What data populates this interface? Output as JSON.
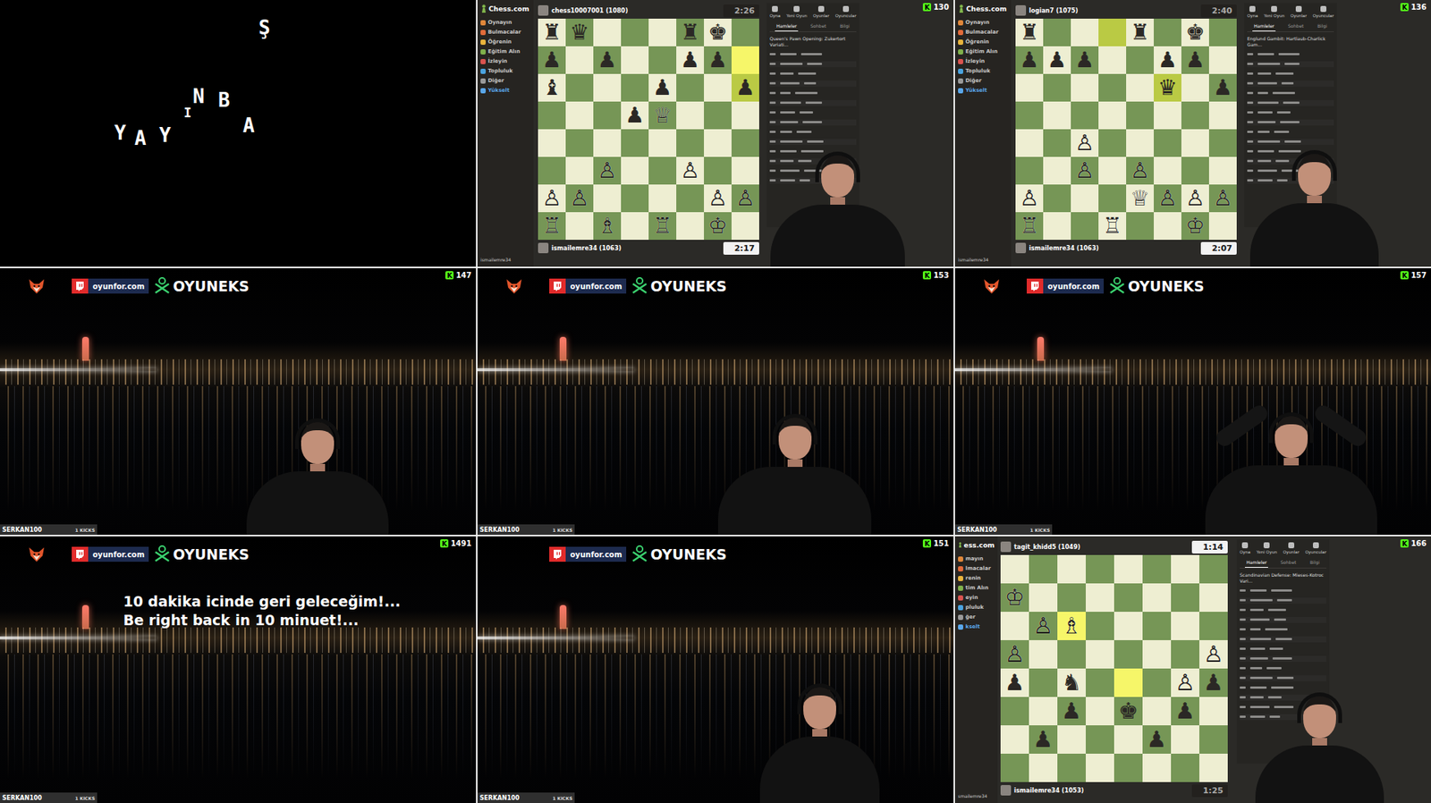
{
  "kick_glyph": "K",
  "tiles": [
    {
      "kind": "intro",
      "letters": [
        "Y",
        "A",
        "Y",
        "I",
        "N",
        "B",
        "A",
        "Ş"
      ]
    },
    {
      "kind": "chess",
      "kicks": "130",
      "on_camera": true,
      "sidebar": {
        "logo": "Chess.com",
        "user": "ismailemre34",
        "items": [
          {
            "label": "Oynayın",
            "accent": false
          },
          {
            "label": "Bulmacalar",
            "accent": false
          },
          {
            "label": "Öğrenin",
            "accent": false
          },
          {
            "label": "Eğitim Alın",
            "accent": false
          },
          {
            "label": "İzleyin",
            "accent": false
          },
          {
            "label": "Topluluk",
            "accent": false
          },
          {
            "label": "Diğer",
            "accent": false
          },
          {
            "label": "Yükselt",
            "accent": true
          }
        ]
      },
      "top_player": {
        "name": "chess10007001 (1080)",
        "clock": {
          "time": "2:26",
          "active": false
        }
      },
      "bottom_player": {
        "name": "ismailemre34 (1063)",
        "clock": {
          "time": "2:17",
          "active": true
        }
      },
      "board": {
        "ranks": [
          "♜♛   ♜♚ ",
          "♟ ♟  ♟♟ ",
          "♝   ♟  ♟",
          "   ♟♕   ",
          "        ",
          "  ♙  ♙  ",
          "♙♙    ♙♙",
          "♖ ♗ ♖ ♔ "
        ],
        "highlights": [
          "h7",
          "h6"
        ]
      },
      "panel": {
        "tabs": [
          "Oyna",
          "Yeni Oyun",
          "Oyunlar",
          "Oyuncular"
        ],
        "subtabs": [
          {
            "label": "Hamleler",
            "selected": true
          },
          {
            "label": "Sohbet",
            "selected": false
          },
          {
            "label": "Bilgi",
            "selected": false
          }
        ],
        "opening": "Queen's Pawn Opening: Zukertort Variati..."
      }
    },
    {
      "kind": "chess",
      "kicks": "136",
      "on_camera": true,
      "sidebar": {
        "logo": "Chess.com",
        "user": "ismailemre34",
        "items": [
          {
            "label": "Oynayın",
            "accent": false
          },
          {
            "label": "Bulmacalar",
            "accent": false
          },
          {
            "label": "Öğrenin",
            "accent": false
          },
          {
            "label": "Eğitim Alın",
            "accent": false
          },
          {
            "label": "İzleyin",
            "accent": false
          },
          {
            "label": "Topluluk",
            "accent": false
          },
          {
            "label": "Diğer",
            "accent": false
          },
          {
            "label": "Yükselt",
            "accent": true
          }
        ]
      },
      "top_player": {
        "name": "logian7 (1075)",
        "clock": {
          "time": "2:40",
          "active": false
        }
      },
      "bottom_player": {
        "name": "ismailemre34 (1063)",
        "clock": {
          "time": "2:07",
          "active": true
        }
      },
      "board": {
        "ranks": [
          "♜   ♜ ♚ ",
          "♟♟♟  ♟♟ ",
          "     ♛ ♟",
          "        ",
          "  ♙     ",
          "  ♙ ♙   ",
          "♙   ♕♙♙♙",
          "♖  ♖  ♔ "
        ],
        "highlights": [
          "d8",
          "f6"
        ]
      },
      "panel": {
        "tabs": [
          "Oyna",
          "Yeni Oyun",
          "Oyunlar",
          "Oyuncular"
        ],
        "subtabs": [
          {
            "label": "Hamleler",
            "selected": true
          },
          {
            "label": "Sohbet",
            "selected": false
          },
          {
            "label": "Bilgi",
            "selected": false
          }
        ],
        "opening": "Englund Gambit: Hartlaub-Charlick Gam..."
      }
    },
    {
      "kind": "stream",
      "kicks": "147",
      "on_camera": true,
      "fox": true,
      "promo": "oyunfor.com",
      "brand": "OYUNEKS",
      "streamer": "SERKAN100",
      "kick_label": "1 KICKS",
      "message": []
    },
    {
      "kind": "stream",
      "kicks": "153",
      "on_camera": true,
      "fox": true,
      "promo": "oyunfor.com",
      "brand": "OYUNEKS",
      "streamer": "SERKAN100",
      "kick_label": "1 KICKS",
      "message": []
    },
    {
      "kind": "stream",
      "kicks": "157",
      "on_camera": true,
      "fox": true,
      "promo": "oyunfor.com",
      "brand": "OYUNEKS",
      "streamer": "SERKAN100",
      "kick_label": "1 KICKS",
      "message": []
    },
    {
      "kind": "stream",
      "kicks": "1491",
      "on_camera": false,
      "fox": true,
      "promo": "oyunfor.com",
      "brand": "OYUNEKS",
      "streamer": "SERKAN100",
      "kick_label": "1 KICKS",
      "message": [
        "10 dakika icinde geri geleceğim!...",
        "Be right back in 10 minuet!..."
      ]
    },
    {
      "kind": "stream",
      "kicks": "151",
      "on_camera": true,
      "fox": false,
      "promo": "oyunfor.com",
      "brand": "OYUNEKS",
      "streamer": "SERKAN100",
      "kick_label": "1 KICKS",
      "message": []
    },
    {
      "kind": "chess",
      "kicks": "166",
      "on_camera": true,
      "sidebar": {
        "logo": "ess.com",
        "user": "smailemre34",
        "items": [
          {
            "label": "mayın",
            "accent": false
          },
          {
            "label": "lmacalar",
            "accent": false
          },
          {
            "label": "renin",
            "accent": false
          },
          {
            "label": "tim Alın",
            "accent": false
          },
          {
            "label": "eyin",
            "accent": false
          },
          {
            "label": "pluluk",
            "accent": false
          },
          {
            "label": "ğer",
            "accent": false
          },
          {
            "label": "kselt",
            "accent": true
          }
        ]
      },
      "top_player": {
        "name": "tagit_khidd5 (1049)",
        "clock": {
          "time": "1:14",
          "active": true
        }
      },
      "bottom_player": {
        "name": "ismailemre34 (1053)",
        "clock": {
          "time": "1:25",
          "active": false
        }
      },
      "board": {
        "ranks": [
          "        ",
          "♔       ",
          " ♙♗     ",
          "♙      ♙",
          "♟ ♞   ♙♟",
          "  ♟ ♚ ♟ ",
          " ♟   ♟  ",
          "        "
        ],
        "highlights": [
          "c6",
          "e4"
        ]
      },
      "panel": {
        "tabs": [
          "Oyna",
          "Yeni Oyun",
          "Oyunlar",
          "Oyuncular"
        ],
        "subtabs": [
          {
            "label": "Hamleler",
            "selected": true
          },
          {
            "label": "Sohbet",
            "selected": false
          },
          {
            "label": "Bilgi",
            "selected": false
          }
        ],
        "opening": "Scandinavian Defense: Mieses-Kotroc Vari..."
      }
    }
  ]
}
